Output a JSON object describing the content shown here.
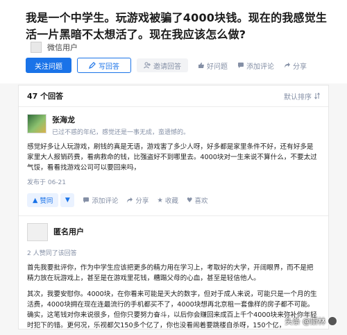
{
  "question": {
    "title": "我是一个中学生。玩游戏被骗了4000块钱。现在的我感觉生活一片黑暗不太想活了。现在我应该怎么做?",
    "asker": "微信用户"
  },
  "actions": {
    "follow": "关注问题",
    "write": "写回答",
    "invite": "邀请回答",
    "good": "好问题",
    "comment": "添加评论",
    "share": "分享"
  },
  "answers_header": {
    "count": "47 个回答",
    "sort": "默认排序"
  },
  "answer1": {
    "author": "张海龙",
    "bio": "已过不惑的年纪，感觉还是一事无成，蛮遗憾的。",
    "text": "感觉好多让人玩游戏，刷钱的真是无语，游戏害了多少人呀，好多都是家里条件不好，还有好多是家里大人报销药费，看病救命的钱，比强盗好不到哪里去。4000块对一生来说不算什么，不要太过气馁，看看找游戏公司可以要回来吗，",
    "date": "发布于 06-21",
    "upvote": "赞同",
    "comment": "添加评论",
    "share": "分享",
    "collect": "收藏",
    "like": "喜欢"
  },
  "answer2": {
    "author": "匿名用户",
    "likes": "2 人赞同了该回答",
    "para1": "首先我要批评你，作为中学生应该把更多的精力用在学习上，考取好的大学，开阔眼界，而不是把精力放在玩游戏上，甚至是在游戏里花钱，糟蹋父母的心血，甚至是轻信他人。",
    "para2": "其次，我要安慰你。4000块，在你看来可能是天大的数字，但对于成人来说，可能只是一个月的生活费，4000块拥在现在连最流行的手机都买不了，4000块想再北京租一套像样的房子都不可能。确实，这笔钱对你来说很多，但你只要努力奋斗，以后你会赚回来成百上千个4000块来弥补你年轻时犯下的错。更何况，乐视都欠150多个亿了，你也没看闹着要跳楼自杀呀，150个亿，"
  },
  "watermark": "头条 @斯林"
}
